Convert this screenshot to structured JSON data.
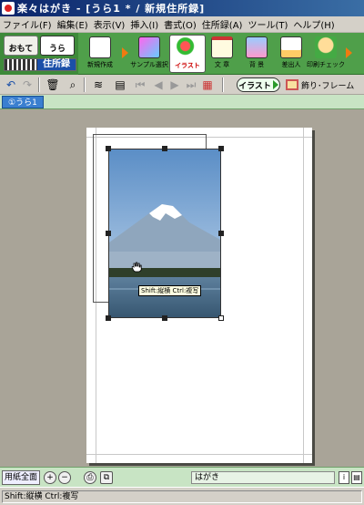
{
  "window": {
    "title": "楽々はがき - [うら1 * / 新規住所録]"
  },
  "menu": [
    "ファイル(F)",
    "編集(E)",
    "表示(V)",
    "挿入(I)",
    "書式(O)",
    "住所録(A)",
    "ツール(T)",
    "ヘルプ(H)"
  ],
  "ribbon": {
    "tab_front": "おもて",
    "tab_back": "うら",
    "address_book": "住所録",
    "buttons": [
      {
        "label": "新規作成",
        "icon": "new-doc-icon"
      },
      {
        "label": "サンプル選択",
        "icon": "sample-select-icon"
      },
      {
        "label": "イラスト",
        "icon": "illustration-icon",
        "active": true
      },
      {
        "label": "文 章",
        "icon": "text-icon"
      },
      {
        "label": "背 景",
        "icon": "background-icon"
      },
      {
        "label": "差出人",
        "icon": "sender-icon"
      },
      {
        "label": "印刷チェック",
        "icon": "print-check-icon"
      }
    ]
  },
  "toolbar": {
    "illust_mode": "イラスト",
    "frame_label": "飾り･フレーム"
  },
  "doc_tab": "①うら1",
  "canvas": {
    "tooltip": "Shift:縦横 Ctrl:複写"
  },
  "bottom": {
    "fit_label": "用紙全面",
    "paper_type": "はがき"
  },
  "status": {
    "text": "Shift:縦横 Ctrl:複写"
  },
  "colors": {
    "ribbon": "#4f9f4a",
    "title": "#0a246a",
    "canvas": "#a9a498"
  }
}
